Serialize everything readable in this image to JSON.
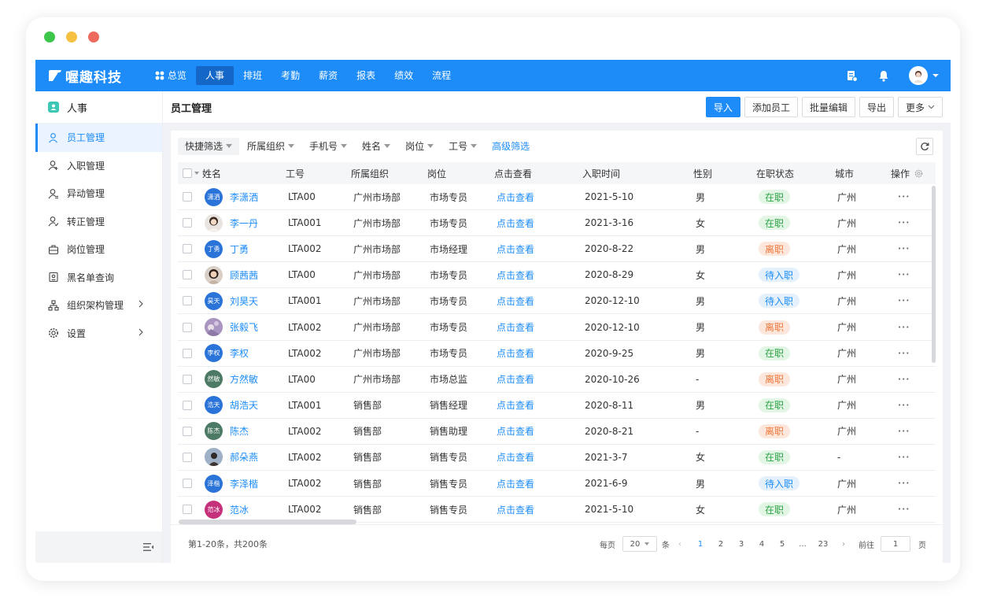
{
  "app": {
    "brand": "喔趣科技"
  },
  "topnav": [
    {
      "label": "总览",
      "active": false
    },
    {
      "label": "人事",
      "active": true
    },
    {
      "label": "排班",
      "active": false
    },
    {
      "label": "考勤",
      "active": false
    },
    {
      "label": "薪资",
      "active": false
    },
    {
      "label": "报表",
      "active": false
    },
    {
      "label": "绩效",
      "active": false
    },
    {
      "label": "流程",
      "active": false
    }
  ],
  "sidebar": {
    "title": "人事",
    "items": [
      {
        "label": "员工管理",
        "icon": "user-icon",
        "active": true
      },
      {
        "label": "入职管理",
        "icon": "user-add-icon"
      },
      {
        "label": "异动管理",
        "icon": "user-transfer-icon"
      },
      {
        "label": "转正管理",
        "icon": "user-check-icon"
      },
      {
        "label": "岗位管理",
        "icon": "briefcase-icon"
      },
      {
        "label": "黑名单查询",
        "icon": "id-card-icon"
      },
      {
        "label": "组织架构管理",
        "icon": "org-chart-icon",
        "chevron": true
      },
      {
        "label": "设置",
        "icon": "gear-icon",
        "chevron": true
      }
    ]
  },
  "header": {
    "title": "员工管理",
    "actions": [
      "导入",
      "添加员工",
      "批量编辑",
      "导出",
      "更多"
    ]
  },
  "filters": [
    "快捷筛选",
    "所属组织",
    "手机号",
    "姓名",
    "岗位",
    "工号"
  ],
  "advanced_filter": "高级筛选",
  "table": {
    "columns": [
      "姓名",
      "工号",
      "所属组织",
      "岗位",
      "点击查看",
      "入职时间",
      "性别",
      "在职状态",
      "城市",
      "操作"
    ],
    "rows": [
      {
        "avatar_text": "潇洒",
        "avatar_color": "#2a73d9",
        "name": "李潇洒",
        "id": "LTA00",
        "org": "广州市场部",
        "pos": "市场专员",
        "view": "点击查看",
        "date": "2021-5-10",
        "sex": "男",
        "status": "在职",
        "city": "广州"
      },
      {
        "avatar_text": "",
        "avatar_color": "#e9e4df",
        "name": "李一丹",
        "id": "LTA001",
        "org": "广州市场部",
        "pos": "市场专员",
        "view": "点击查看",
        "date": "2021-3-16",
        "sex": "女",
        "status": "在职",
        "city": "广州"
      },
      {
        "avatar_text": "丁勇",
        "avatar_color": "#2a73d9",
        "name": "丁勇",
        "id": "LTA002",
        "org": "广州市场部",
        "pos": "市场经理",
        "view": "点击查看",
        "date": "2020-8-22",
        "sex": "男",
        "status": "离职",
        "city": "广州"
      },
      {
        "avatar_text": "",
        "avatar_color": "#d9cfc7",
        "name": "顾茜茜",
        "id": "LTA00",
        "org": "广州市场部",
        "pos": "市场专员",
        "view": "点击查看",
        "date": "2020-8-29",
        "sex": "女",
        "status": "待入职",
        "city": "广州"
      },
      {
        "avatar_text": "昊天",
        "avatar_color": "#2a73d9",
        "name": "刘昊天",
        "id": "LTA001",
        "org": "广州市场部",
        "pos": "市场专员",
        "view": "点击查看",
        "date": "2020-12-10",
        "sex": "男",
        "status": "待入职",
        "city": "广州"
      },
      {
        "avatar_text": "",
        "avatar_color": "#b8a6c9",
        "name": "张毅飞",
        "id": "LTA002",
        "org": "广州市场部",
        "pos": "市场专员",
        "view": "点击查看",
        "date": "2020-12-10",
        "sex": "男",
        "status": "离职",
        "city": "广州"
      },
      {
        "avatar_text": "李权",
        "avatar_color": "#2a73d9",
        "name": "李权",
        "id": "LTA002",
        "org": "广州市场部",
        "pos": "市场专员",
        "view": "点击查看",
        "date": "2020-9-25",
        "sex": "男",
        "status": "在职",
        "city": "广州"
      },
      {
        "avatar_text": "然敏",
        "avatar_color": "#4c7a64",
        "name": "方然敏",
        "id": "LTA00",
        "org": "广州市场部",
        "pos": "市场总监",
        "view": "点击查看",
        "date": "2020-10-26",
        "sex": "-",
        "status": "离职",
        "city": "广州"
      },
      {
        "avatar_text": "浩天",
        "avatar_color": "#2a73d9",
        "name": "胡浩天",
        "id": "LTA001",
        "org": "销售部",
        "pos": "销售经理",
        "view": "点击查看",
        "date": "2020-8-11",
        "sex": "男",
        "status": "在职",
        "city": "广州"
      },
      {
        "avatar_text": "陈杰",
        "avatar_color": "#4c7a64",
        "name": "陈杰",
        "id": "LTA002",
        "org": "销售部",
        "pos": "销售助理",
        "view": "点击查看",
        "date": "2020-8-21",
        "sex": "-",
        "status": "离职",
        "city": "广州"
      },
      {
        "avatar_text": "",
        "avatar_color": "#a9b7c9",
        "name": "郝朵燕",
        "id": "LTA002",
        "org": "销售部",
        "pos": "销售专员",
        "view": "点击查看",
        "date": "2021-3-7",
        "sex": "女",
        "status": "在职",
        "city": "-"
      },
      {
        "avatar_text": "泽楷",
        "avatar_color": "#2a73d9",
        "name": "李泽楷",
        "id": "LTA002",
        "org": "销售部",
        "pos": "销售专员",
        "view": "点击查看",
        "date": "2021-6-9",
        "sex": "男",
        "status": "待入职",
        "city": "广州"
      },
      {
        "avatar_text": "范冰",
        "avatar_color": "#c4307a",
        "name": "范冰",
        "id": "LTA002",
        "org": "销售部",
        "pos": "销售专员",
        "view": "点击查看",
        "date": "2021-5-10",
        "sex": "女",
        "status": "在职",
        "city": "广州"
      }
    ]
  },
  "status_colors": {
    "在职": {
      "bg": "#e3f6e6",
      "fg": "#2ba245"
    },
    "离职": {
      "bg": "#fde7dc",
      "fg": "#f0783c"
    },
    "待入职": {
      "bg": "#e4f1fd",
      "fg": "#1d8cf8"
    }
  },
  "footer": {
    "total": "第1-20条，共200条",
    "per_page_label": "每页",
    "per_page": "20",
    "per_page_unit": "条",
    "pages": [
      "1",
      "2",
      "3",
      "4",
      "5",
      "...",
      "23"
    ],
    "current_page": "1",
    "goto_label": "前往",
    "goto_value": "1",
    "goto_unit": "页"
  },
  "colors": {
    "accent": "#1d8cf8",
    "nav_active": "#1467c6"
  }
}
